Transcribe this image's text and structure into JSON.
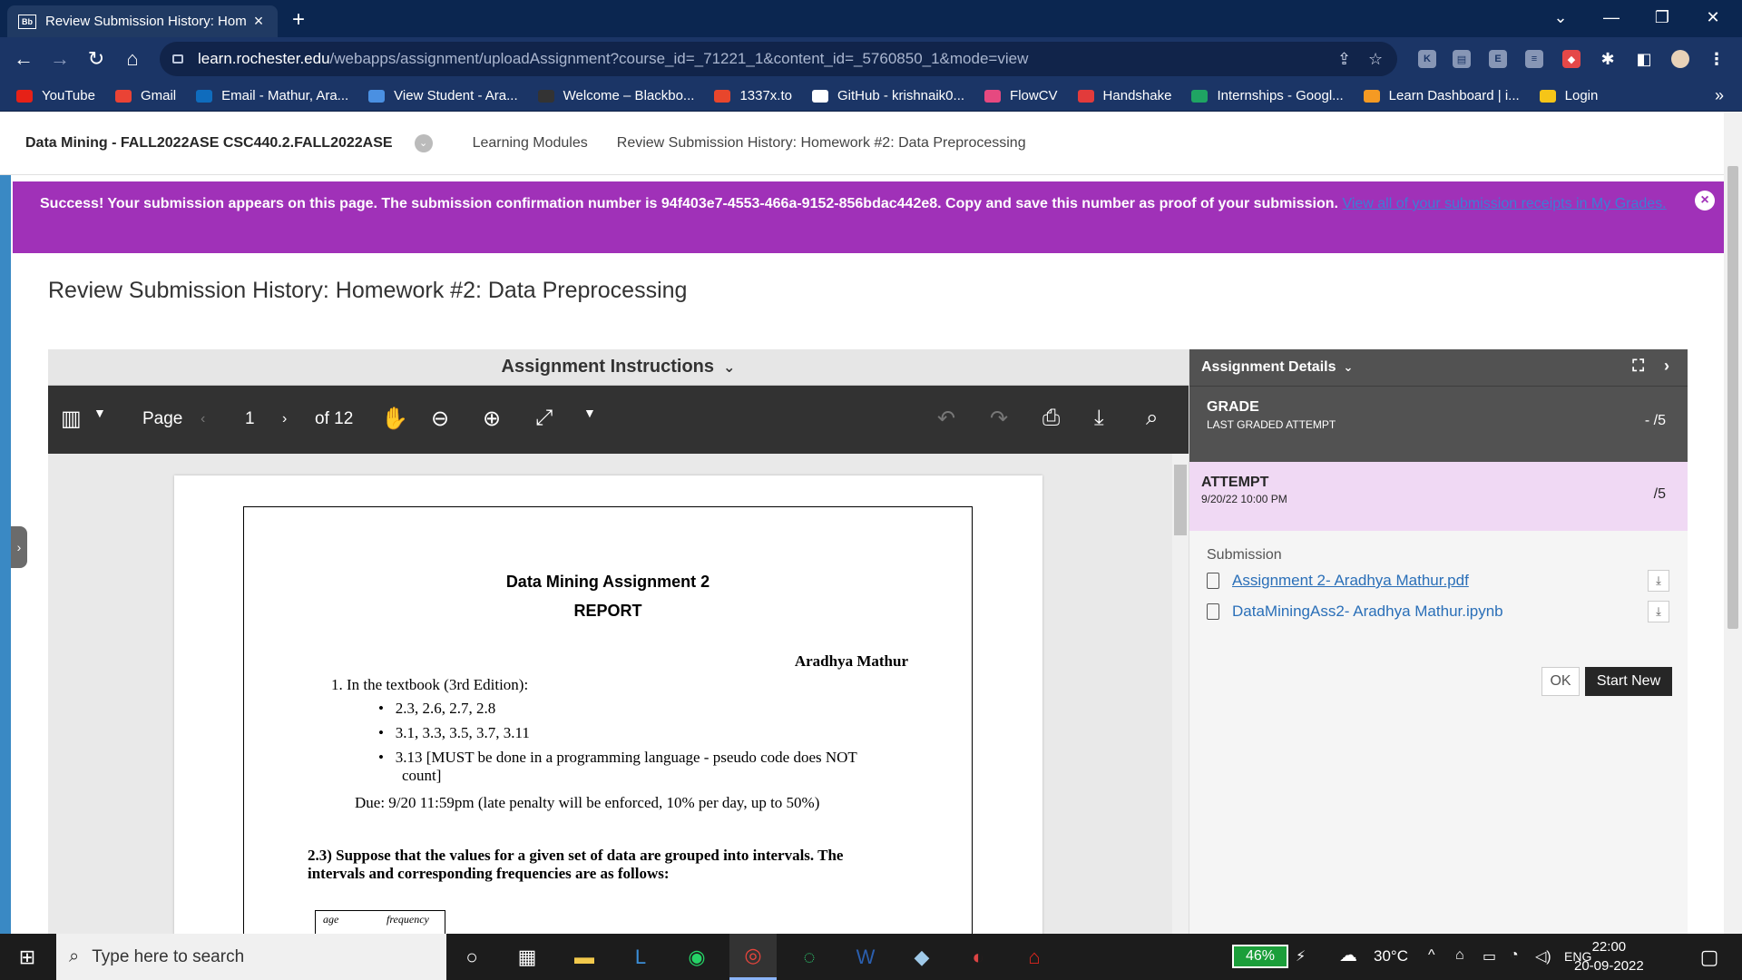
{
  "browser": {
    "tab_title": "Review Submission History: Hom",
    "tab_icon_text": "Bb",
    "url_host": "learn.rochester.edu",
    "url_path": "/webapps/assignment/uploadAssignment?course_id=_71221_1&content_id=_5760850_1&mode=view"
  },
  "bookmarks": [
    {
      "label": "YouTube",
      "color": "#e62117"
    },
    {
      "label": "Gmail",
      "color": "#ea4335"
    },
    {
      "label": "Email - Mathur, Ara...",
      "color": "#0f6cbd"
    },
    {
      "label": "View Student - Ara...",
      "color": "#4a90e2"
    },
    {
      "label": "Welcome – Blackbo...",
      "color": "#333333"
    },
    {
      "label": "1337x.to",
      "color": "#e8462c"
    },
    {
      "label": "GitHub - krishnaik0...",
      "color": "#ffffff"
    },
    {
      "label": "FlowCV",
      "color": "#e64980"
    },
    {
      "label": "Handshake",
      "color": "#e23b3b"
    },
    {
      "label": "Internships - Googl...",
      "color": "#1fa463"
    },
    {
      "label": "Learn Dashboard | i...",
      "color": "#f59a23"
    },
    {
      "label": "Login",
      "color": "#f5c518"
    }
  ],
  "breadcrumbs": {
    "course": "Data Mining - FALL2022ASE CSC440.2.FALL2022ASE",
    "items": [
      "Learning Modules",
      "Review Submission History: Homework #2: Data Preprocessing"
    ]
  },
  "banner": {
    "text": "Success! Your submission appears on this page. The submission confirmation number is 94f403e7-4553-466a-9152-856bdac442e8. Copy and save this number as proof of your submission.",
    "link": "View all of your submission receipts in My Grades."
  },
  "page_title": "Review Submission History: Homework #2: Data Preprocessing",
  "viewer": {
    "instructions_label": "Assignment Instructions",
    "page_label": "Page",
    "current_page": "1",
    "of_pages": "of 12"
  },
  "document": {
    "title": "Data Mining Assignment 2",
    "subtitle": "REPORT",
    "author": "Aradhya Mathur",
    "item1": "1.   In the textbook (3rd Edition):",
    "bullets": [
      "2.3, 2.6, 2.7, 2.8",
      "3.1, 3.3, 3.5, 3.7, 3.11",
      "3.13 [MUST be done in a programming language - pseudo code does NOT",
      "count]"
    ],
    "due": "Due: 9/20  11:59pm (late penalty will be enforced, 10% per day, up to 50%)",
    "q1": "2.3) Suppose that the values for a given set of data are grouped into intervals. The",
    "q2": "intervals and corresponding frequencies are as follows:",
    "table_headers": [
      "age",
      "frequency"
    ]
  },
  "details": {
    "header": "Assignment Details",
    "grade_label": "GRADE",
    "grade_sub": "LAST GRADED ATTEMPT",
    "grade_score": "- /5",
    "attempt_label": "ATTEMPT",
    "attempt_date": "9/20/22 10:00 PM",
    "attempt_score": "/5",
    "submission_label": "Submission",
    "files": [
      "Assignment 2- Aradhya Mathur.pdf",
      "DataMiningAss2- Aradhya Mathur.ipynb"
    ],
    "ok_label": "OK",
    "start_new_label": "Start New"
  },
  "taskbar": {
    "search_placeholder": "Type here to search",
    "battery": "46%",
    "weather": "30°C",
    "lang": "ENG",
    "time": "22:00",
    "date": "20-09-2022"
  }
}
